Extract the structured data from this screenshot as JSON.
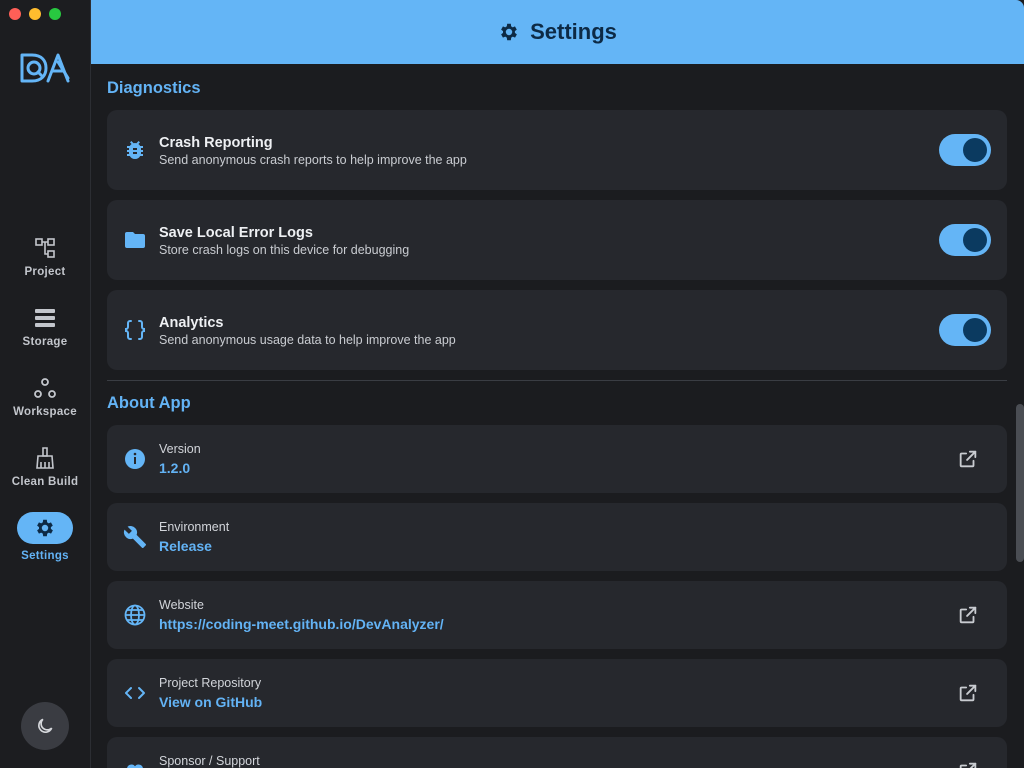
{
  "header": {
    "title": "Settings",
    "icon": "gear-icon"
  },
  "sidebar": {
    "items": [
      {
        "label": "Project",
        "icon": "project-tree-icon"
      },
      {
        "label": "Storage",
        "icon": "storage-icon"
      },
      {
        "label": "Workspace",
        "icon": "workspace-icon"
      },
      {
        "label": "Clean Build",
        "icon": "broom-icon"
      },
      {
        "label": "Settings",
        "icon": "gear-icon",
        "active": true
      }
    ],
    "theme_toggle_icon": "moon-icon"
  },
  "diagnostics": {
    "title": "Diagnostics",
    "items": [
      {
        "title": "Crash Reporting",
        "subtitle": "Send anonymous crash reports to help improve the app",
        "enabled": true,
        "icon": "bug-icon"
      },
      {
        "title": "Save Local Error Logs",
        "subtitle": "Store crash logs on this device for debugging",
        "enabled": true,
        "icon": "folder-icon"
      },
      {
        "title": "Analytics",
        "subtitle": "Send anonymous usage data to help improve the app",
        "enabled": true,
        "icon": "braces-icon"
      }
    ]
  },
  "about": {
    "title": "About App",
    "items": [
      {
        "label": "Version",
        "value": "1.2.0",
        "icon": "info-icon",
        "external": true
      },
      {
        "label": "Environment",
        "value": "Release",
        "icon": "wrench-icon",
        "external": false
      },
      {
        "label": "Website",
        "value": "https://coding-meet.github.io/DevAnalyzer/",
        "icon": "globe-icon",
        "external": true
      },
      {
        "label": "Project Repository",
        "value": "View on GitHub",
        "icon": "code-icon",
        "external": true
      },
      {
        "label": "Sponsor / Support",
        "value": "",
        "icon": "heart-icon",
        "external": true
      }
    ]
  },
  "colors": {
    "accent": "#64b5f6",
    "background": "#1b1c1f",
    "card": "#26282d",
    "knob": "#0b3a60"
  }
}
